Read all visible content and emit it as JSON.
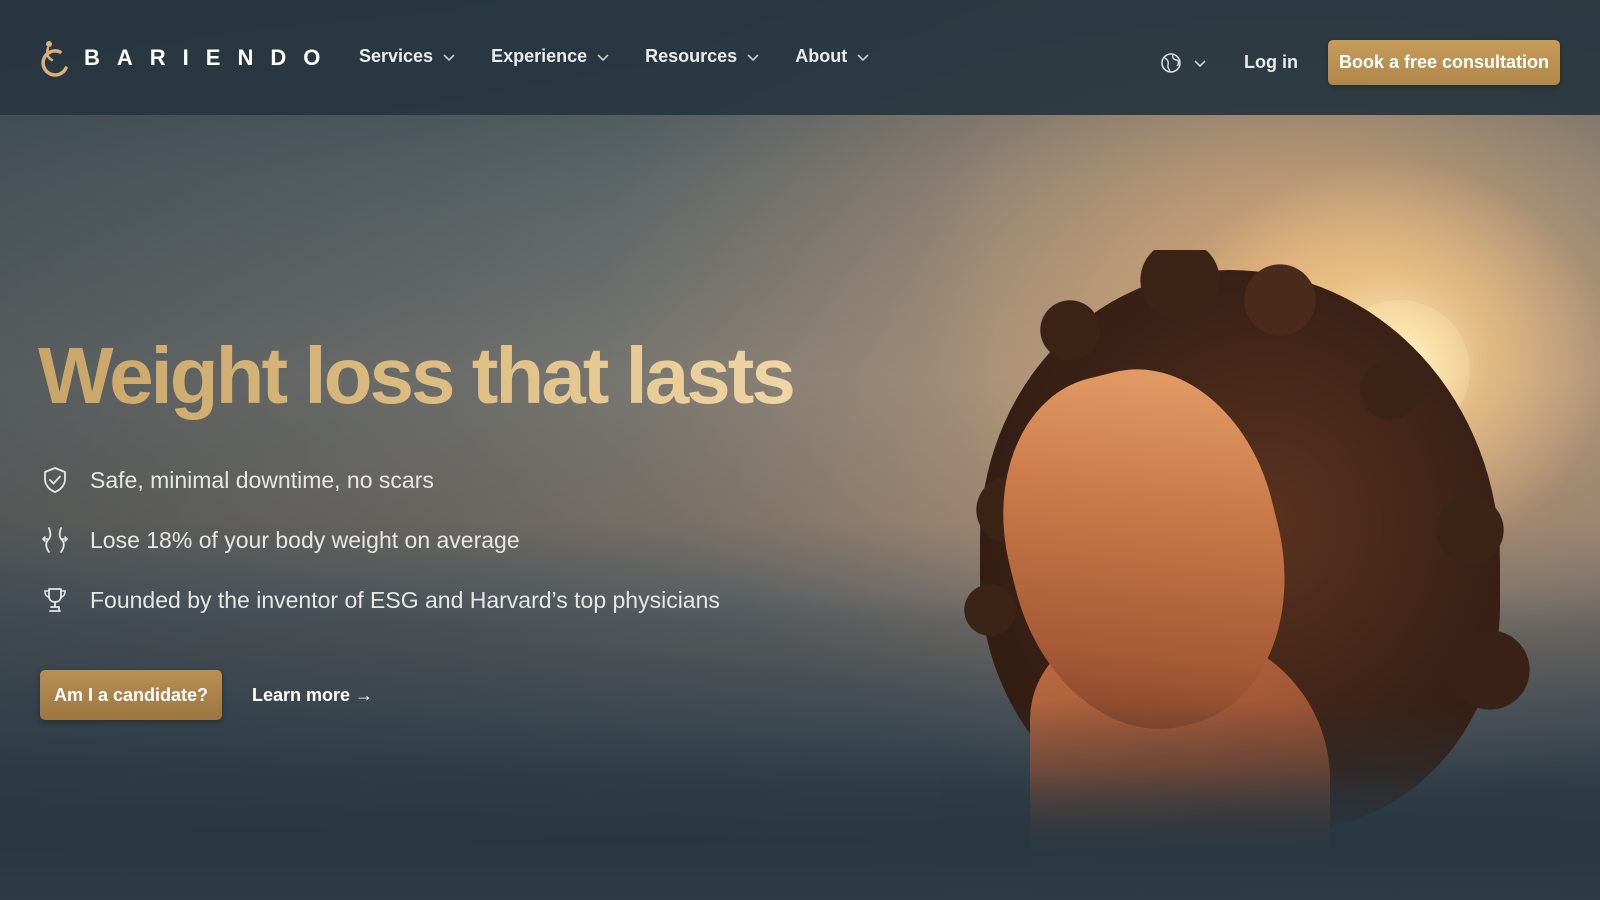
{
  "brand": {
    "name": "BARIENDO"
  },
  "nav": {
    "items": [
      {
        "label": "Services"
      },
      {
        "label": "Experience"
      },
      {
        "label": "Resources"
      },
      {
        "label": "About"
      }
    ],
    "login_label": "Log in",
    "cta_label": "Book a free consultation"
  },
  "hero": {
    "headline": "Weight loss that lasts",
    "features": [
      {
        "icon": "shield-check-icon",
        "text": "Safe, minimal downtime, no scars"
      },
      {
        "icon": "body-waist-icon",
        "text": "Lose 18% of your body weight on average"
      },
      {
        "icon": "trophy-icon",
        "text": "Founded by the inventor of ESG and Harvard’s top physicians"
      }
    ],
    "primary_cta": "Am I a candidate?",
    "secondary_cta": "Learn more →"
  },
  "colors": {
    "accent_gold": "#b99054",
    "header_bg": "#26353f",
    "headline_gold": "#dcbb80"
  }
}
